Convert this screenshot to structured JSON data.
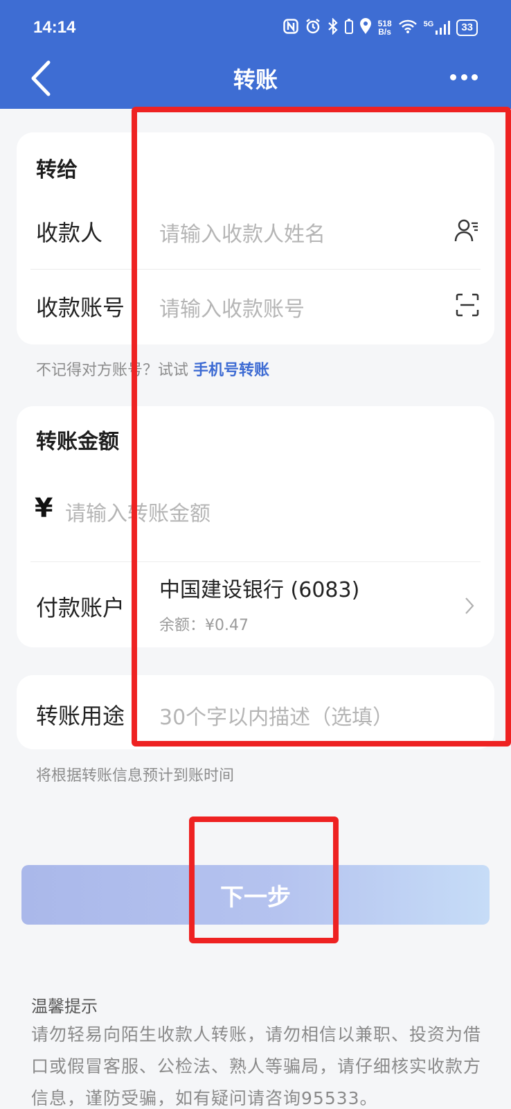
{
  "status_bar": {
    "time": "14:14",
    "net_speed_value": "518",
    "net_speed_unit": "B/s",
    "network": "5G",
    "battery": "33"
  },
  "header": {
    "title": "转账",
    "back_icon": "chevron-left-icon",
    "more_icon": "more-horizontal-icon"
  },
  "payee_card": {
    "section_title": "转给",
    "payee_label": "收款人",
    "payee_placeholder": "请输入收款人姓名",
    "account_label": "收款账号",
    "account_placeholder": "请输入收款账号",
    "contact_icon": "contact-icon",
    "scan_icon": "scan-icon"
  },
  "phone_hint": {
    "text": "不记得对方账号？试试",
    "link": "手机号转账"
  },
  "amount_card": {
    "section_title": "转账金额",
    "currency_symbol": "¥",
    "amount_placeholder": "请输入转账金额",
    "pay_account_label": "付款账户",
    "bank_name": "中国建设银行 (6083)",
    "balance": "余额：¥0.47"
  },
  "purpose_card": {
    "label": "转账用途",
    "placeholder": "30个字以内描述（选填）"
  },
  "arrival_hint": "将根据转账信息预计到账时间",
  "next_button": "下一步",
  "tips": {
    "title": "温馨提示",
    "text": "请勿轻易向陌生收款人转账，请勿相信以兼职、投资为借口或假冒客服、公检法、熟人等骗局，请仔细核实收款方信息，谨防受骗，如有疑问请咨询95533。"
  },
  "colors": {
    "header_bg": "#3e6dd3",
    "link": "#3d6bd3",
    "annotation": "#ee2222",
    "button_gradient_start": "#aab8ea",
    "button_gradient_end": "#c6dcf7"
  }
}
